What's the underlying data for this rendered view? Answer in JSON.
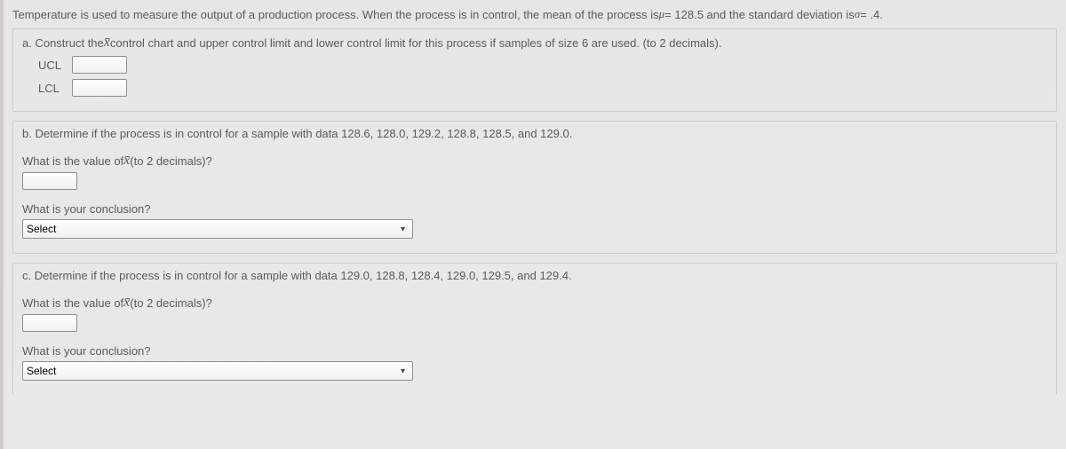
{
  "intro": {
    "text_before_mu": "Temperature is used to measure the output of a production process. When the process is in control, the mean of the process is ",
    "mu_sym": "μ",
    "mu_eq": " = 128.5 and the standard deviation is ",
    "sigma_sym": "σ",
    "sigma_eq": " = .4."
  },
  "a": {
    "prompt_pre": "a. Construct the ",
    "xbar": "x̄",
    "prompt_post": " control chart and upper control limit and lower control limit for this process if samples of size 6 are used. (to 2 decimals).",
    "ucl_label": "UCL",
    "lcl_label": "LCL",
    "ucl_value": "",
    "lcl_value": ""
  },
  "b": {
    "prompt": "b. Determine if the process is in control for a sample with data 128.6, 128.0, 129.2, 128.8, 128.5, and 129.0.",
    "value_q_pre": "What is the value of ",
    "xbar": "x̄",
    "value_q_post": " (to 2 decimals)?",
    "value": "",
    "conclusion_q": "What is your conclusion?",
    "select_placeholder": "Select"
  },
  "c": {
    "prompt": "c. Determine if the process is in control for a sample with data 129.0, 128.8, 128.4, 129.0, 129.5, and 129.4.",
    "value_q_pre": "What is the value of ",
    "xbar": "x̄",
    "value_q_post": " (to 2 decimals)?",
    "value": "",
    "conclusion_q": "What is your conclusion?",
    "select_placeholder": "Select"
  }
}
